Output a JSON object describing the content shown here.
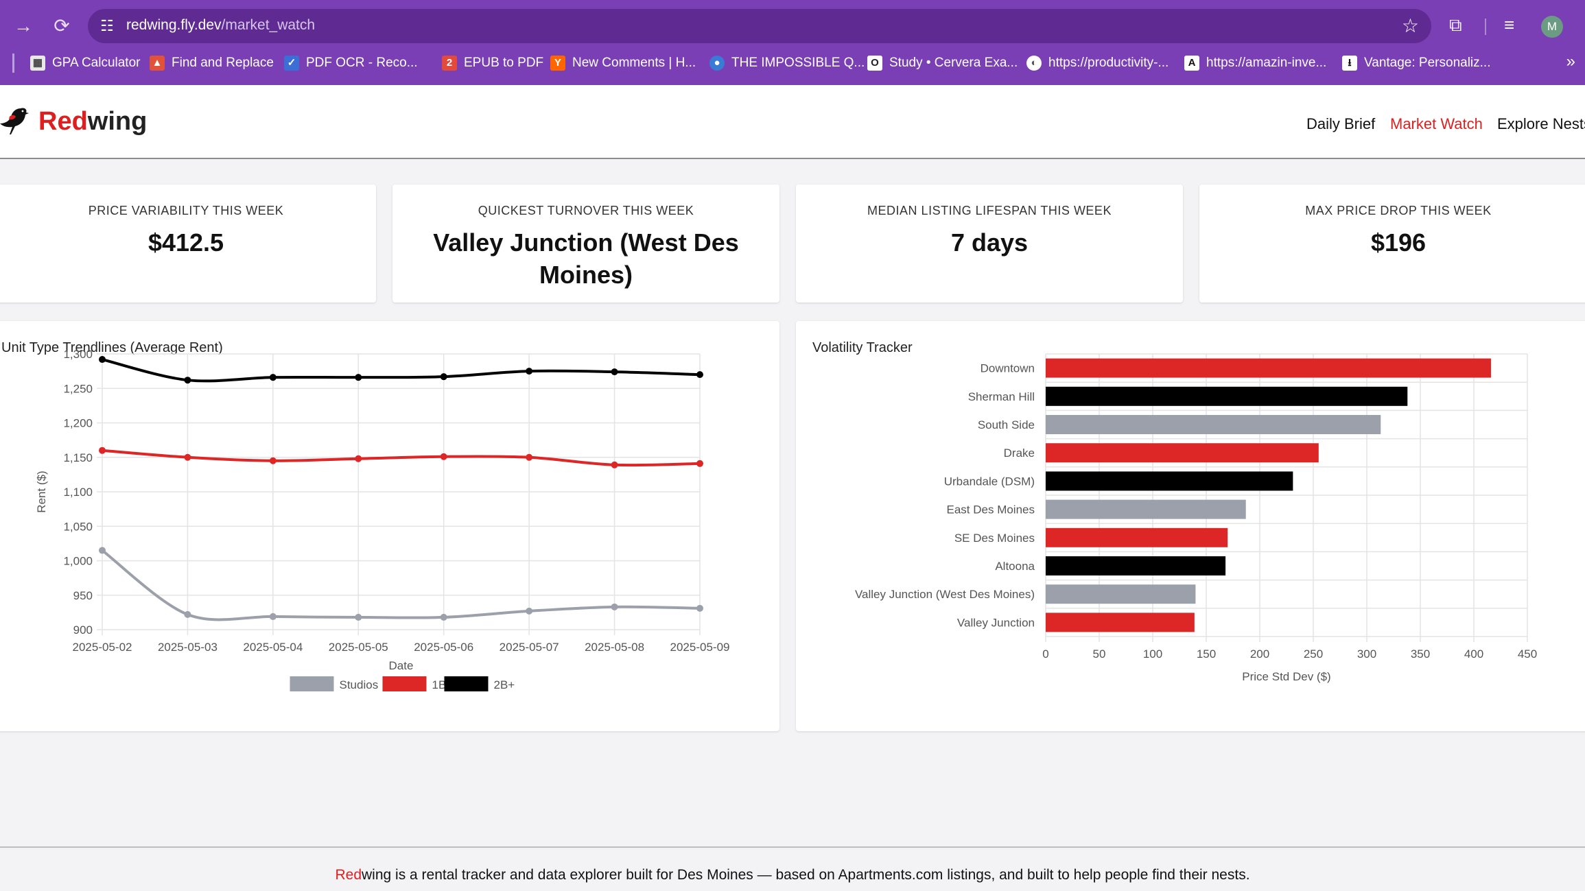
{
  "browser": {
    "url_host": "redwing.fly.dev",
    "url_path": "/market_watch",
    "avatar_letter": "M",
    "bookmarks": [
      {
        "label": "GPA Calculator",
        "icon": "grid-icon",
        "color": "#e8e8e8"
      },
      {
        "label": "Find and Replace",
        "icon": "tree-icon",
        "color": "#e0533a"
      },
      {
        "label": "PDF OCR - Reco...",
        "icon": "pdf-icon",
        "color": "#3b6fd6"
      },
      {
        "label": "EPUB to PDF",
        "icon": "epub-icon",
        "color": "#e24a3b"
      },
      {
        "label": "New Comments | H...",
        "icon": "hn-icon",
        "color": "#ff6600"
      },
      {
        "label": "THE IMPOSSIBLE Q...",
        "icon": "globe-icon",
        "color": "#3a7bd5"
      },
      {
        "label": "Study • Cervera Exa...",
        "icon": "study-icon",
        "color": "#ffffff"
      },
      {
        "label": "https://productivity-...",
        "icon": "web-icon",
        "color": "#ffffff"
      },
      {
        "label": "https://amazin-inve...",
        "icon": "a-icon",
        "color": "#ffffff"
      },
      {
        "label": "Vantage: Personaliz...",
        "icon": "download-icon",
        "color": "#ffffff"
      }
    ]
  },
  "site": {
    "logo_red": "Red",
    "logo_rest": "wing",
    "nav": [
      {
        "label": "Daily Brief",
        "active": false
      },
      {
        "label": "Market Watch",
        "active": true
      },
      {
        "label": "Explore Nests",
        "active": false
      }
    ]
  },
  "kpis": [
    {
      "label": "PRICE VARIABILITY THIS WEEK",
      "value": "$412.5"
    },
    {
      "label": "QUICKEST TURNOVER THIS WEEK",
      "value": "Valley Junction (West Des Moines)"
    },
    {
      "label": "MEDIAN LISTING LIFESPAN THIS WEEK",
      "value": "7 days"
    },
    {
      "label": "MAX PRICE DROP THIS WEEK",
      "value": "$196"
    }
  ],
  "chart_data": [
    {
      "type": "line",
      "title": "Unit Type Trendlines (Average Rent)",
      "xlabel": "Date",
      "ylabel": "Rent ($)",
      "ylim": [
        900,
        1300
      ],
      "yticks": [
        900,
        950,
        1000,
        1050,
        1100,
        1150,
        1200,
        1250,
        1300
      ],
      "yticklabels": [
        "900",
        "950",
        "1,000",
        "1,050",
        "1,100",
        "1,150",
        "1,200",
        "1,250",
        "1,300"
      ],
      "x": [
        "2025-05-02",
        "2025-05-03",
        "2025-05-04",
        "2025-05-05",
        "2025-05-06",
        "2025-05-07",
        "2025-05-08",
        "2025-05-09"
      ],
      "grid": true,
      "legend_position": "bottom",
      "series": [
        {
          "name": "Studios",
          "color": "#9ca0aa",
          "values": [
            1015,
            922,
            919,
            918,
            918,
            927,
            933,
            931
          ]
        },
        {
          "name": "1B",
          "color": "#dd2626",
          "values": [
            1160,
            1150,
            1145,
            1148,
            1151,
            1150,
            1139,
            1141
          ]
        },
        {
          "name": "2B+",
          "color": "#000000",
          "values": [
            1292,
            1262,
            1266,
            1266,
            1267,
            1275,
            1274,
            1270
          ]
        }
      ]
    },
    {
      "type": "bar",
      "orientation": "horizontal",
      "title": "Volatility Tracker",
      "xlabel": "Price Std Dev ($)",
      "xlim": [
        0,
        450
      ],
      "xticks": [
        0,
        50,
        100,
        150,
        200,
        250,
        300,
        350,
        400,
        450
      ],
      "grid": true,
      "categories": [
        "Downtown",
        "Sherman Hill",
        "South Side",
        "Drake",
        "Urbandale (DSM)",
        "East Des Moines",
        "SE Des Moines",
        "Altoona",
        "Valley Junction (West Des Moines)",
        "Valley Junction"
      ],
      "values": [
        416,
        338,
        313,
        255,
        231,
        187,
        170,
        168,
        140,
        139
      ],
      "colors": [
        "#dd2626",
        "#000000",
        "#9ca0aa",
        "#dd2626",
        "#000000",
        "#9ca0aa",
        "#dd2626",
        "#000000",
        "#9ca0aa",
        "#dd2626"
      ]
    }
  ],
  "footer": {
    "brand_red": "Red",
    "text": "wing is a rental tracker and data explorer built for Des Moines — based on Apartments.com listings, and built to help people find their nests."
  }
}
